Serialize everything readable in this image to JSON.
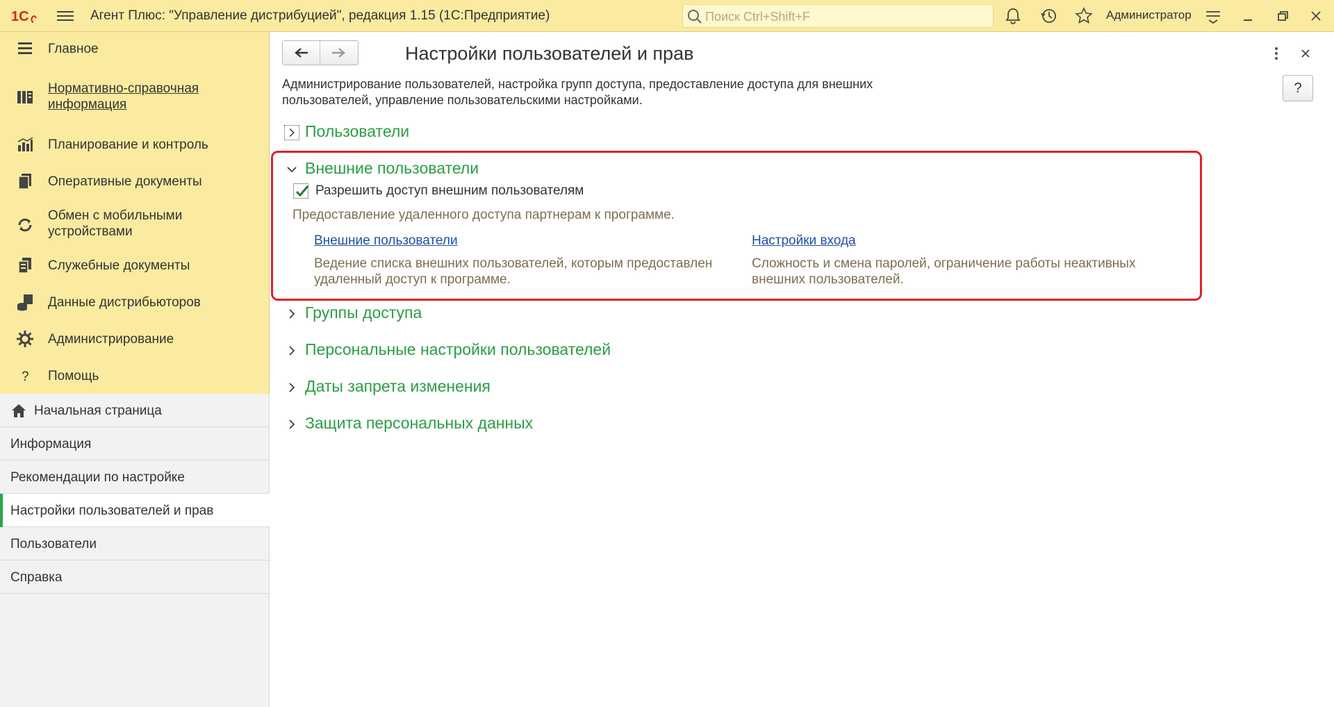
{
  "topbar": {
    "logo_text": "1С",
    "app_title": "Агент Плюс: \"Управление дистрибуцией\", редакция 1.15  (1С:Предприятие)",
    "search_placeholder": "Поиск Ctrl+Shift+F",
    "search_value": "",
    "user_name": "Администратор",
    "icons": [
      "menu-icon",
      "search-icon",
      "bell-icon",
      "history-icon",
      "star-icon",
      "settings-lines-icon",
      "minimize-icon",
      "restore-icon",
      "close-icon"
    ]
  },
  "sidebar": {
    "sections": [
      {
        "label": "Главное",
        "icon": "menu-lines-icon",
        "link": false
      },
      {
        "label": "Нормативно-справочная информация",
        "icon": "catalog-icon",
        "link": true
      },
      {
        "label": "Планирование и контроль",
        "icon": "bar-chart-icon",
        "link": false
      },
      {
        "label": "Оперативные документы",
        "icon": "documents-icon",
        "link": false
      },
      {
        "label": "Обмен с мобильными устройствами",
        "icon": "exchange-icon",
        "link": false
      },
      {
        "label": "Служебные документы",
        "icon": "service-docs-icon",
        "link": false
      },
      {
        "label": "Данные дистрибьюторов",
        "icon": "distributor-data-icon",
        "link": false
      },
      {
        "label": "Администрирование",
        "icon": "gear-icon",
        "link": false
      },
      {
        "label": "Помощь",
        "icon": "question-icon",
        "link": false
      }
    ],
    "open_windows": [
      {
        "label": "Начальная страница",
        "icon": "home-icon"
      },
      {
        "label": "Информация"
      },
      {
        "label": "Рекомендации по настройке"
      },
      {
        "label": "Настройки пользователей и прав",
        "active": true
      },
      {
        "label": "Пользователи"
      },
      {
        "label": "Справка"
      }
    ]
  },
  "form": {
    "title": "Настройки пользователей и прав",
    "help_label": "?",
    "description": "Администрирование пользователей, настройка групп доступа, предоставление доступа для внешних пользователей, управление пользовательскими настройками.",
    "groups": [
      {
        "title": "Пользователи",
        "expanded": false
      },
      {
        "title": "Внешние пользователи",
        "expanded": true
      },
      {
        "title": "Группы доступа",
        "expanded": false
      },
      {
        "title": "Персональные настройки пользователей",
        "expanded": false
      },
      {
        "title": "Даты запрета изменения",
        "expanded": false
      },
      {
        "title": "Защита персональных данных",
        "expanded": false
      }
    ],
    "external_users": {
      "checkbox_label": "Разрешить доступ внешним пользователям",
      "checkbox_checked": true,
      "checkbox_note": "Предоставление удаленного доступа партнерам к программе.",
      "links": [
        {
          "label": "Внешние пользователи",
          "description": "Ведение списка внешних пользователей, которым предоставлен удаленный доступ к программе."
        },
        {
          "label": "Настройки входа",
          "description": "Сложность и смена паролей, ограничение работы неактивных внешних пользователей."
        }
      ]
    }
  },
  "colors": {
    "topbar_bg": "#fbeba0",
    "group_title": "#2b9e44",
    "link": "#1e4fa8",
    "note_text": "#7b6f52",
    "highlight_border": "#e0212b",
    "active_marker": "#2aa54a"
  }
}
